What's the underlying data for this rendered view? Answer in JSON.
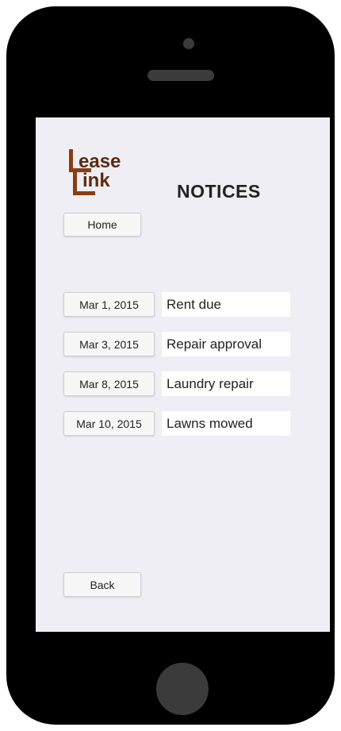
{
  "logo": {
    "line1": "ease",
    "line2": "ink"
  },
  "header": {
    "title": "NOTICES"
  },
  "nav": {
    "home_label": "Home",
    "back_label": "Back"
  },
  "notices": [
    {
      "date": "Mar 1, 2015",
      "text": "Rent due"
    },
    {
      "date": "Mar 3, 2015",
      "text": "Repair approval"
    },
    {
      "date": "Mar 8, 2015",
      "text": "Laundry repair"
    },
    {
      "date": "Mar 10, 2015",
      "text": "Lawns mowed"
    }
  ],
  "colors": {
    "phone_body": "#000000",
    "screen_bg": "#efeef4",
    "logo_brown": "#8b3d12",
    "button_bg": "#f7f7f7"
  }
}
